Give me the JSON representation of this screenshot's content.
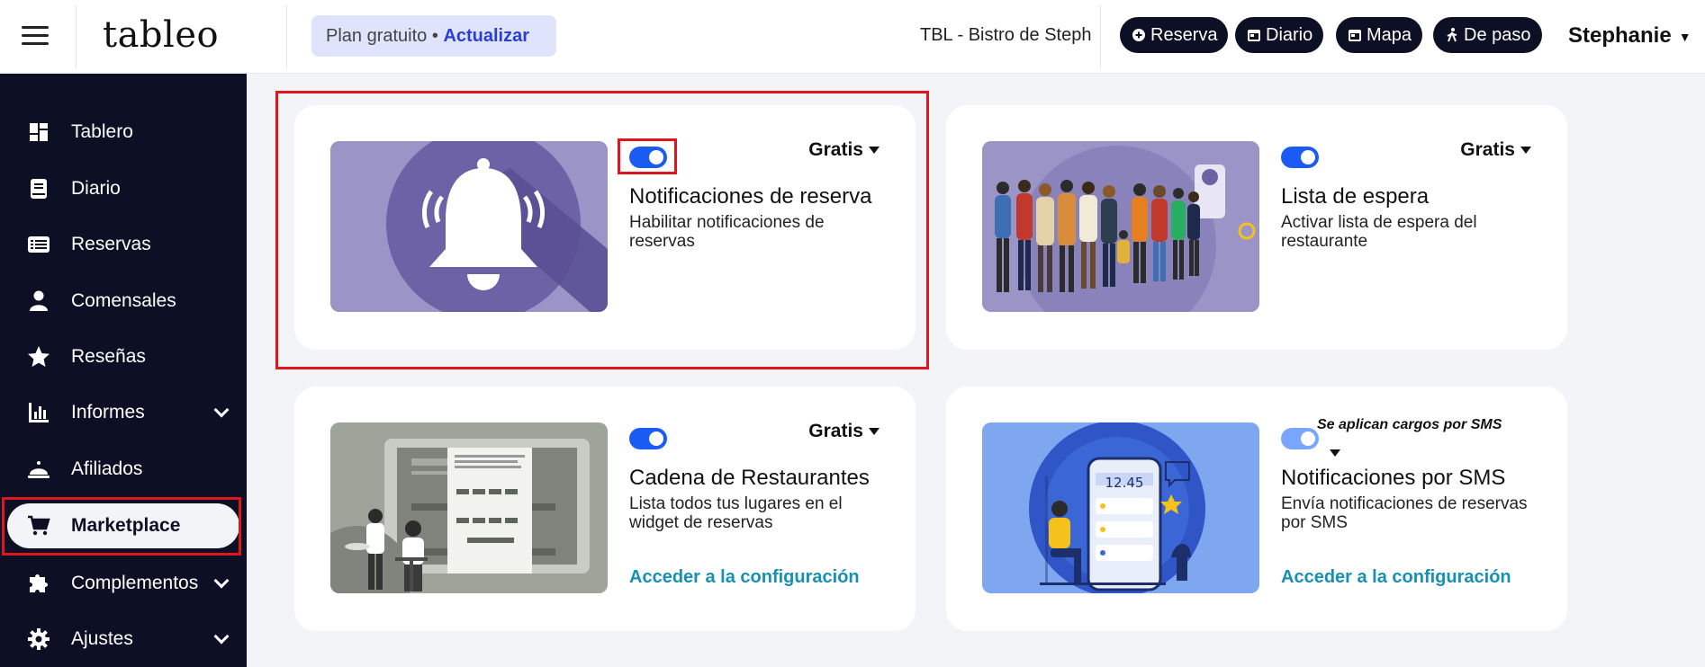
{
  "topbar": {
    "logo": "tableo",
    "plan_label": "Plan gratuito",
    "plan_separator": "•",
    "plan_action": "Actualizar",
    "venue": "TBL - Bistro de Steph",
    "quick_actions": [
      {
        "label": "Reserva",
        "icon": "plus-circle-icon"
      },
      {
        "label": "Diario",
        "icon": "calendar-icon"
      },
      {
        "label": "Mapa",
        "icon": "calendar-icon"
      },
      {
        "label": "De paso",
        "icon": "walking-icon"
      }
    ],
    "user": "Stephanie"
  },
  "sidebar": {
    "items": [
      {
        "label": "Tablero",
        "icon": "dashboard-icon"
      },
      {
        "label": "Diario",
        "icon": "book-icon"
      },
      {
        "label": "Reservas",
        "icon": "list-icon"
      },
      {
        "label": "Comensales",
        "icon": "person-icon"
      },
      {
        "label": "Reseñas",
        "icon": "star-icon"
      },
      {
        "label": "Informes",
        "icon": "chart-icon",
        "expandable": true
      },
      {
        "label": "Afiliados",
        "icon": "cloche-icon"
      },
      {
        "label": "Marketplace",
        "icon": "cart-icon",
        "active": true
      },
      {
        "label": "Complementos",
        "icon": "puzzle-icon",
        "expandable": true
      },
      {
        "label": "Ajustes",
        "icon": "gear-icon",
        "expandable": true
      }
    ]
  },
  "cards": [
    {
      "title": "Notificaciones de reserva",
      "description": "Habilitar notificaciones de reservas",
      "price": "Gratis",
      "enabled": true
    },
    {
      "title": "Lista de espera",
      "description": "Activar lista de espera del restaurante",
      "price": "Gratis",
      "enabled": true
    },
    {
      "title": "Cadena de Restaurantes",
      "description": "Lista todos tus lugares en el widget de reservas",
      "price": "Gratis",
      "enabled": true,
      "link": "Acceder a la configuración"
    },
    {
      "title": "Notificaciones por SMS",
      "description": "Envía notificaciones de reservas por SMS",
      "price": "Se aplican cargos por SMS",
      "enabled": true,
      "link": "Acceder a la configuración",
      "phone_time": "12.45"
    }
  ],
  "colors": {
    "sidebar_bg": "#0d0f24",
    "accent": "#1a5cf3",
    "link": "#1690b4",
    "highlight": "#e0161e",
    "plan_bg": "#dfe3fb"
  }
}
